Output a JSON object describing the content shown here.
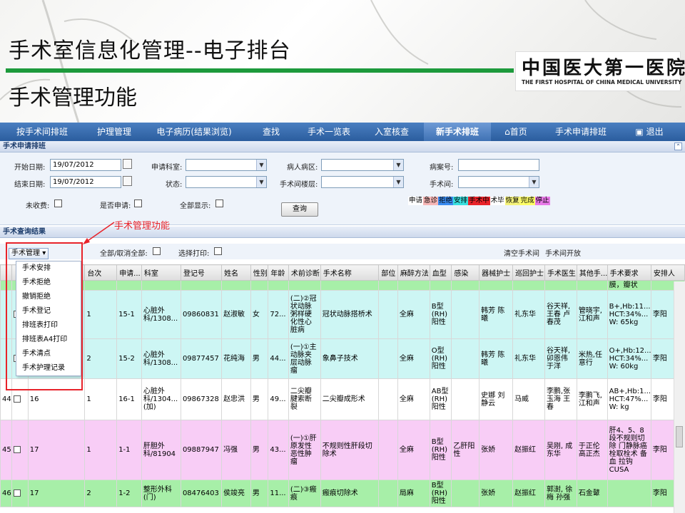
{
  "slide": {
    "title": "手术室信息化管理--电子排台",
    "subtitle": "手术管理功能",
    "logo_cn": "中国医大第一医院",
    "logo_en": "THE FIRST HOSPITAL OF CHINA MEDICAL UNIVERSITY",
    "accent": "#1d9a3c"
  },
  "nav": {
    "items": [
      "按手术间排班",
      "护理管理",
      "电子病历(结果浏览)",
      "查找",
      "手术一览表",
      "入室核查",
      "新手术排班",
      "首页",
      "手术申请排班",
      "退出"
    ],
    "active": "新手术排班",
    "icons": [
      "home-icon",
      "exit-icon"
    ]
  },
  "apply_section": {
    "title": "手术申请排班",
    "start_date_label": "开始日期:",
    "start_date": "19/07/2012",
    "end_date_label": "结束日期:",
    "end_date": "19/07/2012",
    "dept_label": "申请科室:",
    "status_label": "状态:",
    "ward_label": "病人病区:",
    "floor_label": "手术间楼层:",
    "case_no_label": "病案号:",
    "room_label": "手术间:",
    "unpaid_label": "未收费:",
    "reapply_label": "是否申请:",
    "showall_label": "全部显示:",
    "query_button": "查询",
    "legend": [
      {
        "text": "申请",
        "color": "#ffffff"
      },
      {
        "text": "急诊",
        "color": "#f7b6b6"
      },
      {
        "text": "拒绝",
        "color": "#3a8bf0"
      },
      {
        "text": "安排",
        "color": "#39e0e0"
      },
      {
        "text": "手术中",
        "color": "#e8232a"
      },
      {
        "text": "术毕",
        "color": "#ffffff"
      },
      {
        "text": "恢复",
        "color": "#f5f37a"
      },
      {
        "text": "完成",
        "color": "#ffff66"
      },
      {
        "text": "停止",
        "color": "#e87ae8"
      }
    ]
  },
  "results_section": {
    "title": "手术查询结果",
    "annotation": "手术管理功能",
    "menu_button": "手术管理",
    "select_all": "全部/取消全部:",
    "select_print": "选择打印:",
    "clear_room": "清空手术间",
    "room_open": "手术间开放",
    "menu_items": [
      "手术安排",
      "手术拒绝",
      "撤销拒绝",
      "手术登记",
      "排班表打印",
      "排班表A4打印",
      "手术清点",
      "手术护理记录"
    ],
    "columns": [
      "",
      "",
      "",
      "台次",
      "申请...",
      "科室",
      "登记号",
      "姓名",
      "性别",
      "年龄",
      "术前诊断",
      "手术名称",
      "部位",
      "麻醉方法",
      "血型",
      "感染",
      "器械护士",
      "巡回护士",
      "手术医生",
      "其他手...",
      "手术要求",
      "安排人"
    ],
    "rows": [
      {
        "style": "r-green",
        "cells": [
          "",
          "",
          "",
          "",
          "",
          "",
          "",
          "",
          "",
          "",
          "",
          "",
          "",
          "",
          "",
          "",
          "",
          "",
          "",
          "",
          "膜，瓣状",
          ""
        ]
      },
      {
        "style": "r-cyan",
        "cells": [
          "",
          "",
          "",
          "1",
          "15-1",
          "心脏外科/1308...",
          "09860831",
          "赵淑敏",
          "女",
          "72...",
          "(二)②冠状动脉粥样硬化性心脏病",
          "冠状动脉搭桥术",
          "",
          "全麻",
          "B型(RH)阳性",
          "",
          "韩芳 陈曦",
          "礼东华",
          "谷天祥,王春 卢春茂",
          "管晓宇, 江和声",
          "B+,Hb:11... HCT:34%... W: 65kg",
          "李阳"
        ]
      },
      {
        "style": "r-cyan",
        "cells": [
          "",
          "",
          "",
          "2",
          "15-2",
          "心脏外科/1308...",
          "09877457",
          "花纯海",
          "男",
          "44...",
          "(一)①主动脉夹层动脉瘤",
          "象鼻子技术",
          "",
          "全麻",
          "O型(RH)阳性",
          "",
          "韩芳 陈曦",
          "礼东华",
          "谷天祥,卯恩伟 于洋",
          "米热,任意行",
          "O+,Hb:12... HCT:34%... W: 60kg",
          "李阳"
        ]
      },
      {
        "style": "r-white",
        "cells": [
          "44",
          "",
          "16",
          "1",
          "16-1",
          "心脏外科/1304...(加)",
          "09867328",
          "赵忠洪",
          "男",
          "49...",
          "二尖瓣腱索断裂",
          "二尖瓣成形术",
          "",
          "全麻",
          "AB型(RH)阳性",
          "",
          "史娜 刘静云",
          "马威",
          "李鹏,张玉海 王春",
          "李鹏飞, 江和声",
          "AB+,Hb:1... HCT:47%... W: kg",
          "李阳"
        ]
      },
      {
        "style": "r-pink",
        "cells": [
          "45",
          "",
          "17",
          "1",
          "1-1",
          "肝胆外科/81904",
          "09887947",
          "冯强",
          "男",
          "43...",
          "(一)①肝原发性恶性肿瘤",
          "不规则性肝段切除术",
          "",
          "全麻",
          "B型(RH)阳性",
          "乙肝阳性",
          "张娇",
          "赵振红",
          "吴刚, 成东华",
          "于正伦 高正杰",
          "肝4、5、8段不规则切除 门静脉癌栓取栓术 备血 拉钩 CUSA",
          "李阳"
        ]
      },
      {
        "style": "r-green",
        "cells": [
          "46",
          "",
          "17",
          "2",
          "1-2",
          "整形外科(门)",
          "08476403",
          "侯竣亮",
          "男",
          "11...",
          "(二)③瘢痕",
          "瘢痕切除术",
          "",
          "局麻",
          "B型(RH)阳性",
          "",
          "张娇",
          "赵振红",
          "郭澍, 徐梅 孙强",
          "石金鼙",
          "",
          "李阳"
        ]
      }
    ]
  }
}
